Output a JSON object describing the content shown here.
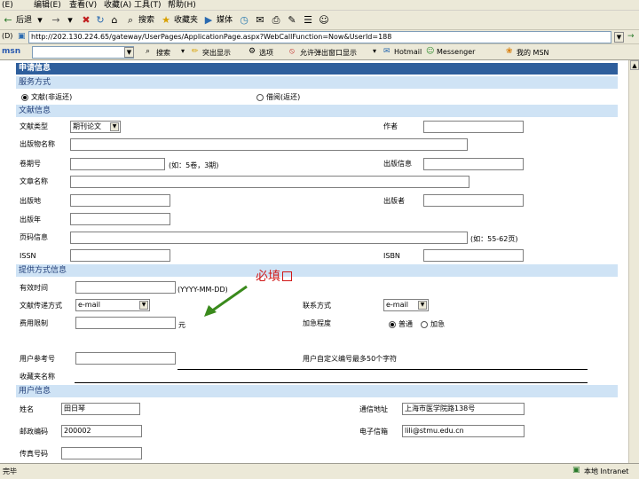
{
  "browser": {
    "menu": [
      "(E)",
      "编辑(E)",
      "查看(V)",
      "收藏(A)",
      "工具(T)",
      "帮助(H)"
    ],
    "toolbar": {
      "back": "后退",
      "search": "搜索",
      "favorites": "收藏夹",
      "media": "媒体"
    },
    "address_label": "(D)",
    "address_url": "http://202.130.224.65/gateway/UserPages/ApplicationPage.aspx?WebCallFunction=Now&UserId=188",
    "links": {
      "search": "搜索",
      "popup_block": "突出显示",
      "options": "选项",
      "popup_allow": "允许弹出窗口显示",
      "hotmail": "Hotmail",
      "messenger": "Messenger",
      "my_msn": "我的 MSN"
    }
  },
  "form": {
    "title": "申请信息",
    "service_section": "服务方式",
    "service_options": [
      "文献(非返还)",
      "借阅(返还)"
    ],
    "doc_section": "文献信息",
    "doc_type_label": "文献类型",
    "doc_type_value": "期刊论文",
    "author_label": "作者",
    "pub_title_label": "出版物名称",
    "volume_label": "卷期号",
    "volume_hint": "(如：5卷，3期)",
    "pub_info_label": "出版信息",
    "article_title_label": "文章名称",
    "editor_label": "出版地",
    "publisher_label": "出版者",
    "year_label": "出版年",
    "pages_label": "页码信息",
    "pages_hint": "(如：55-62页)",
    "issn_label": "ISSN",
    "isbn_label": "ISBN",
    "delivery_section": "提供方式信息",
    "required_annotation": "必填",
    "deadline_label": "有效时间",
    "deadline_hint": "(YYYY-MM-DD)",
    "transfer_label": "文献传递方式",
    "transfer_value": "e-mail",
    "contact_label": "联系方式",
    "contact_value": "e-mail",
    "fee_label": "费用限制",
    "fee_unit": "元",
    "urgency_label": "加急程度",
    "urgency_options": [
      "普通",
      "加急"
    ],
    "ref_label": "用户参考号",
    "ref_hint": "用户自定义编号最多50个字符",
    "fav_label": "收藏夹名称",
    "user_section": "用户信息",
    "name_label": "姓名",
    "name_value": "田日琴",
    "address_label": "通信地址",
    "address_value": "上海市医学院路138号",
    "zip_label": "邮政编码",
    "zip_value": "200002",
    "email_label": "电子信箱",
    "email_value": "lili@stmu.edu.cn",
    "fax_label": "传真号码"
  },
  "status": {
    "left": "完毕",
    "right": "本地 Intranet"
  },
  "colors": {
    "header": "#2e5e9c",
    "section": "#cfe3f5",
    "annotation": "#d01818",
    "arrow": "#3a8a1c"
  }
}
